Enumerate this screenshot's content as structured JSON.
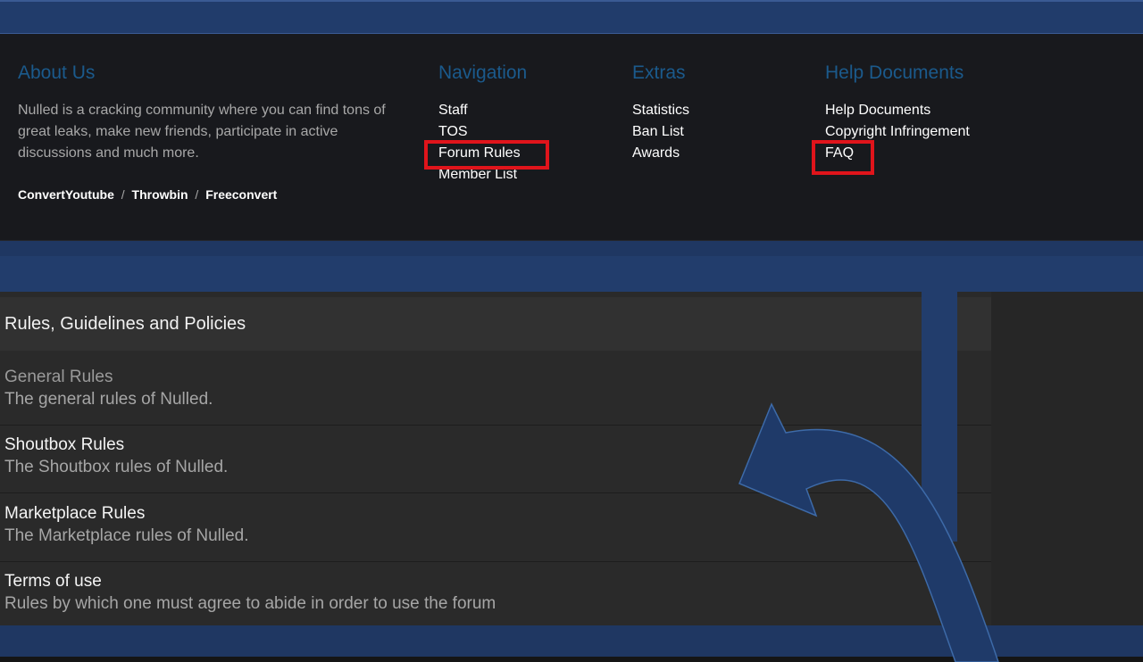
{
  "footer": {
    "about": {
      "heading": "About Us",
      "text": "Nulled is a cracking community where you can find tons of great leaks, make new friends, participate in active discussions and much more.",
      "partners": [
        "ConvertYoutube",
        "Throwbin",
        "Freeconvert"
      ],
      "separator": "/"
    },
    "navigation": {
      "heading": "Navigation",
      "items": [
        "Staff",
        "TOS",
        "Forum Rules",
        "Member List"
      ]
    },
    "extras": {
      "heading": "Extras",
      "items": [
        "Statistics",
        "Ban List",
        "Awards"
      ]
    },
    "help": {
      "heading": "Help Documents",
      "items": [
        "Help Documents",
        "Copyright Infringement",
        "FAQ"
      ]
    }
  },
  "rules_panel": {
    "title": "Rules, Guidelines and Policies",
    "items": [
      {
        "title": "General Rules",
        "description": "The general rules of Nulled."
      },
      {
        "title": "Shoutbox Rules",
        "description": "The Shoutbox rules of Nulled."
      },
      {
        "title": "Marketplace Rules",
        "description": "The Marketplace rules of Nulled."
      },
      {
        "title": "Terms of use",
        "description": "Rules by which one must agree to abide in order to use the forum"
      }
    ]
  },
  "colors": {
    "accent_blue": "#223d6c",
    "heading_blue": "#1b5a8c",
    "highlight_red": "#e0141b"
  }
}
